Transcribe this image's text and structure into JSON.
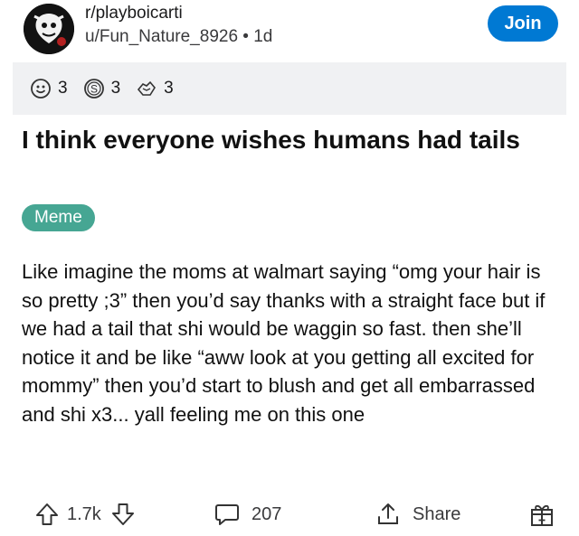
{
  "header": {
    "subreddit": "r/playboicarti",
    "author_line": "u/Fun_Nature_8926 • 1d",
    "join_label": "Join"
  },
  "awards": [
    {
      "icon": "smiley-award-icon",
      "count": "3"
    },
    {
      "icon": "silver-coin-award-icon",
      "count": "3"
    },
    {
      "icon": "helpful-award-icon",
      "count": "3"
    }
  ],
  "post": {
    "title": "I think everyone wishes humans had tails",
    "flair": "Meme",
    "flair_color": "#46a693",
    "body": "Like imagine the moms at walmart saying “omg your hair is so pretty ;3” then you’d say thanks with a straight face but if we had a tail that shi would be waggin so fast. then she’ll notice it and be like “aww look at you getting all excited for mommy” then you’d start to blush and get all embarrassed and shi x3... yall feeling me on this one"
  },
  "actions": {
    "upvote_count": "1.7k",
    "comment_count": "207",
    "share_label": "Share"
  },
  "colors": {
    "accent": "#0079d3",
    "award_bar": "#f0f1f3"
  }
}
